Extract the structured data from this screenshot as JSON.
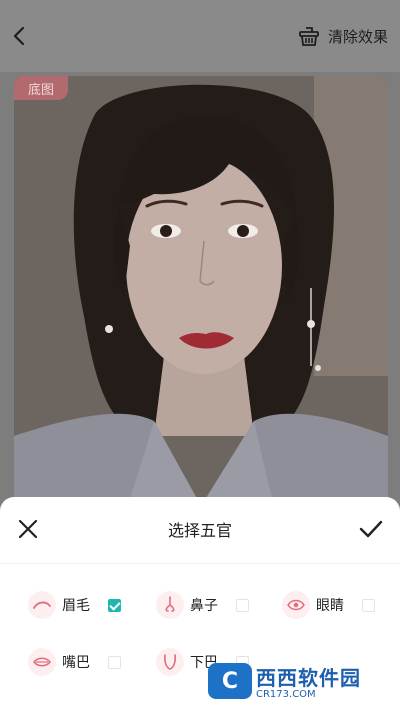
{
  "header": {
    "back_icon": "chevron-left-icon",
    "clear_label": "清除效果",
    "clear_icon": "basket-icon"
  },
  "photo": {
    "badge": "底图"
  },
  "sheet": {
    "title": "选择五官",
    "close_icon": "close-icon",
    "confirm_icon": "check-icon",
    "features": [
      {
        "label": "眉毛",
        "icon": "eyebrow-icon",
        "checked": true
      },
      {
        "label": "鼻子",
        "icon": "nose-icon",
        "checked": false
      },
      {
        "label": "眼睛",
        "icon": "eye-icon",
        "checked": false
      },
      {
        "label": "嘴巴",
        "icon": "mouth-icon",
        "checked": false
      },
      {
        "label": "下巴",
        "icon": "chin-icon",
        "checked": false
      }
    ]
  },
  "colors": {
    "accent_check": "#1fb7b1",
    "icon_bg": "#fdeff0",
    "badge_bg": "#b36a6f"
  },
  "watermark": {
    "logo": "C",
    "text": "西西软件园",
    "url": "CR173.COM"
  }
}
